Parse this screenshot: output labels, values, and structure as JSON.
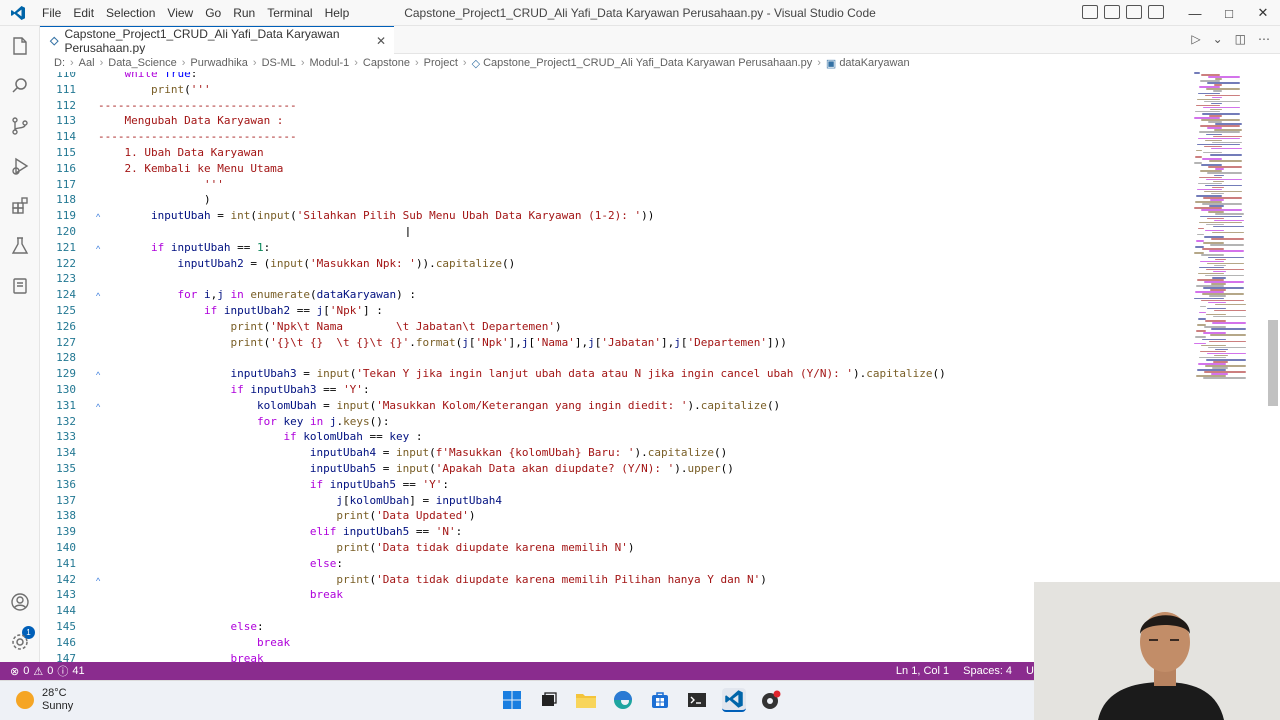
{
  "titlebar": {
    "menu": [
      "File",
      "Edit",
      "Selection",
      "View",
      "Go",
      "Run",
      "Terminal",
      "Help"
    ],
    "window_title": "Capstone_Project1_CRUD_Ali Yafi_Data Karyawan Perusahaan.py - Visual Studio Code"
  },
  "tab": {
    "label": "Capstone_Project1_CRUD_Ali Yafi_Data Karyawan Perusahaan.py",
    "close": "✕"
  },
  "breadcrumb": [
    "D:",
    "Aal",
    "Data_Science",
    "Purwadhika",
    "DS-ML",
    "Modul-1",
    "Capstone",
    "Project",
    "Capstone_Project1_CRUD_Ali Yafi_Data Karyawan Perusahaan.py",
    "dataKaryawan"
  ],
  "editor": {
    "lines": [
      {
        "n": "110",
        "text": "    while True:"
      },
      {
        "n": "111",
        "text": "        print('''"
      },
      {
        "n": "112",
        "text": "------------------------------"
      },
      {
        "n": "113",
        "text": "    Mengubah Data Karyawan :"
      },
      {
        "n": "114",
        "text": "------------------------------"
      },
      {
        "n": "115",
        "text": "    1. Ubah Data Karyawan"
      },
      {
        "n": "116",
        "text": "    2. Kembali ke Menu Utama"
      },
      {
        "n": "117",
        "text": "                '''"
      },
      {
        "n": "118",
        "text": "                )"
      },
      {
        "n": "119",
        "text": "        inputUbah = int(input('Silahkan Pilih Sub Menu Ubah Data Karyawan (1-2): '))"
      },
      {
        "n": "120",
        "text": ""
      },
      {
        "n": "121",
        "text": "        if inputUbah == 1:"
      },
      {
        "n": "122",
        "text": "            inputUbah2 = (input('Masukkan Npk: ')).capitalize()"
      },
      {
        "n": "123",
        "text": ""
      },
      {
        "n": "124",
        "text": "            for i,j in enumerate(dataKaryawan) :"
      },
      {
        "n": "125",
        "text": "                if inputUbah2 == j['Npk'] :"
      },
      {
        "n": "126",
        "text": "                    print('Npk\\t Nama        \\t Jabatan\\t Departemen')"
      },
      {
        "n": "127",
        "text": "                    print('{}\\t {}  \\t {}\\t {}'.format(j['Npk'],j['Nama'],j['Jabatan'],j['Departemen']))"
      },
      {
        "n": "128",
        "text": ""
      },
      {
        "n": "129",
        "text": "                    inputUbah3 = input('Tekan Y jika ingin lanjut ubah data atau N jika ingin cancel ubah (Y/N): ').capitalize()"
      },
      {
        "n": "130",
        "text": "                    if inputUbah3 == 'Y':"
      },
      {
        "n": "131",
        "text": "                        kolomUbah = input('Masukkan Kolom/Keterangan yang ingin diedit: ').capitalize()"
      },
      {
        "n": "132",
        "text": "                        for key in j.keys():"
      },
      {
        "n": "133",
        "text": "                            if kolomUbah == key :"
      },
      {
        "n": "134",
        "text": "                                inputUbah4 = input(f'Masukkan {kolomUbah} Baru: ').capitalize()"
      },
      {
        "n": "135",
        "text": "                                inputUbah5 = input('Apakah Data akan diupdate? (Y/N): ').upper()"
      },
      {
        "n": "136",
        "text": "                                if inputUbah5 == 'Y':"
      },
      {
        "n": "137",
        "text": "                                    j[kolomUbah] = inputUbah4"
      },
      {
        "n": "138",
        "text": "                                    print('Data Updated')"
      },
      {
        "n": "139",
        "text": "                                elif inputUbah5 == 'N':"
      },
      {
        "n": "140",
        "text": "                                    print('Data tidak diupdate karena memilih N')"
      },
      {
        "n": "141",
        "text": "                                else:"
      },
      {
        "n": "142",
        "text": "                                    print('Data tidak diupdate karena memilih Pilihan hanya Y dan N')"
      },
      {
        "n": "143",
        "text": "                                break"
      },
      {
        "n": "144",
        "text": ""
      },
      {
        "n": "145",
        "text": "                    else:"
      },
      {
        "n": "146",
        "text": "                        break"
      },
      {
        "n": "147",
        "text": "                    break"
      }
    ]
  },
  "statusbar": {
    "errors": "0",
    "warnings": "0",
    "info": "41",
    "position": "Ln 1, Col 1",
    "spaces": "Spaces: 4",
    "encoding": "U"
  },
  "activity": {
    "badge": "1"
  },
  "taskbar": {
    "temperature": "28°C",
    "condition": "Sunny"
  },
  "colors": {
    "accent": "#005fb8",
    "statusbar": "#8a2c8e",
    "keyword": "#0000ff",
    "control": "#af00db",
    "string": "#a31515",
    "function": "#795e26",
    "variable": "#001080"
  }
}
